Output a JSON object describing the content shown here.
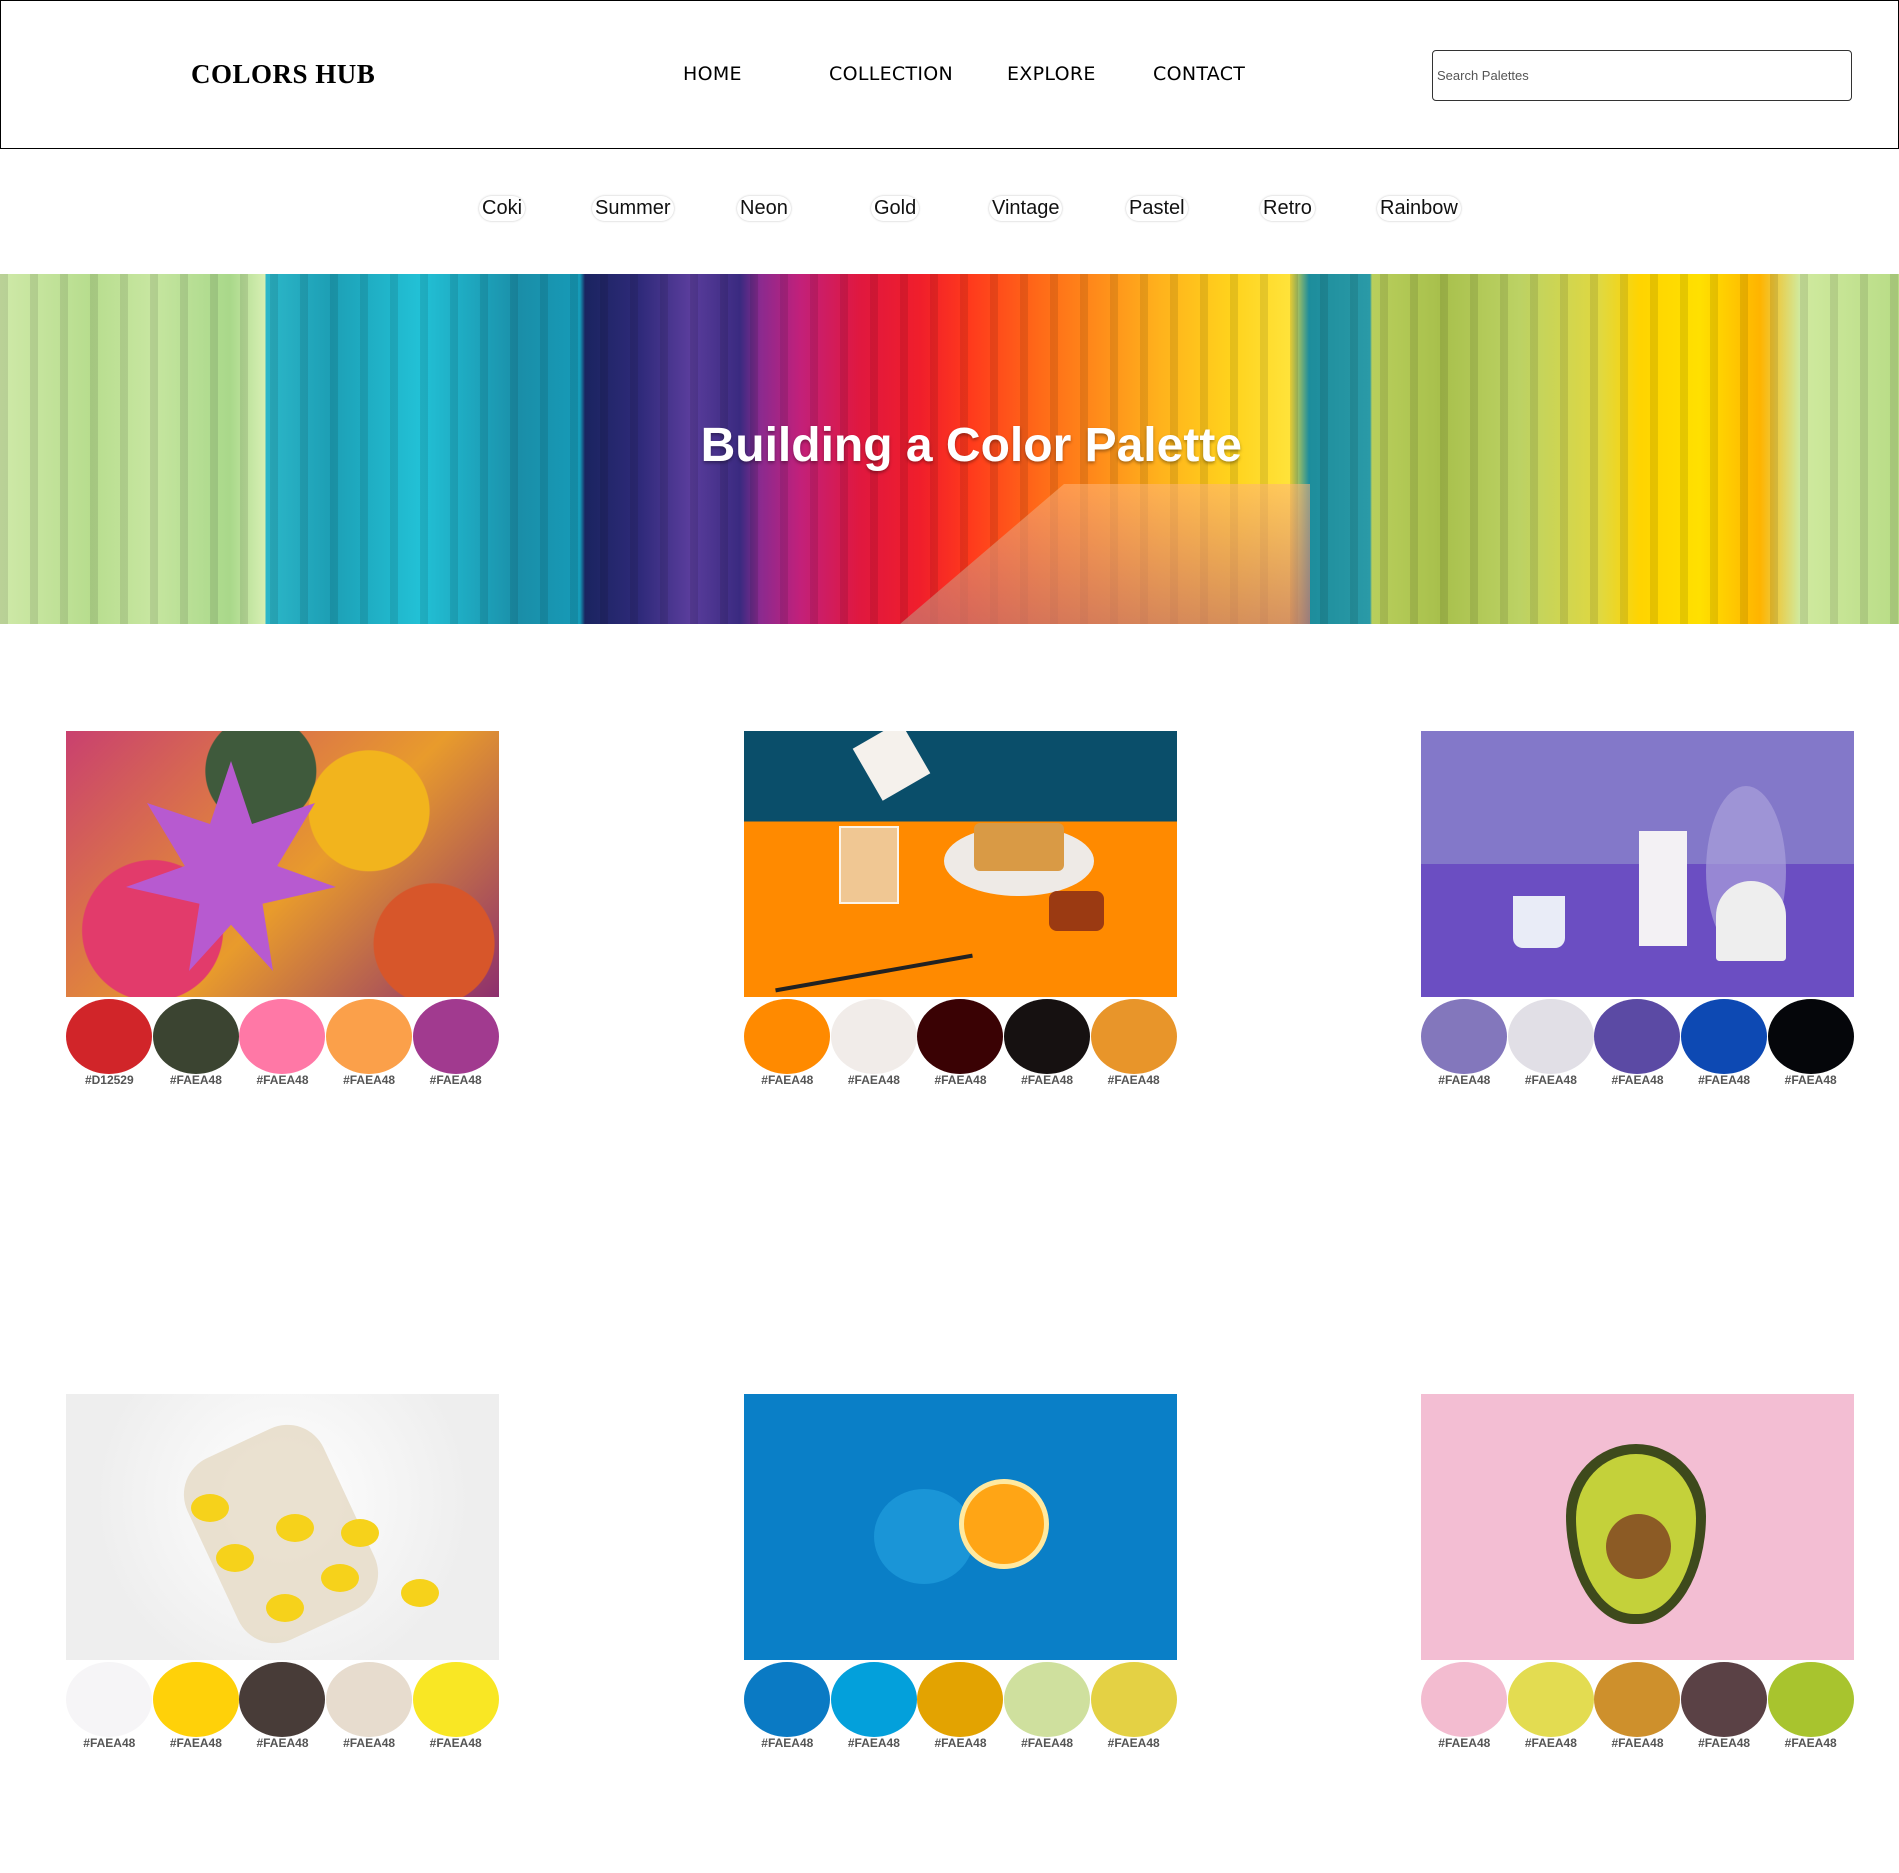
{
  "header": {
    "logo": "COLORS HUB",
    "nav": [
      "HOME",
      "COLLECTION",
      "EXPLORE",
      "CONTACT"
    ],
    "search_placeholder": "Search Palettes"
  },
  "categories": [
    "Coki",
    "Summer",
    "Neon",
    "Gold",
    "Vintage",
    "Pastel",
    "Retro",
    "Rainbow"
  ],
  "hero": {
    "title": "Building a Color Palette"
  },
  "palettes": [
    {
      "photo": "autumn-leaves",
      "colors": [
        "#D12529",
        "#3B4431",
        "#FF78A6",
        "#FBA04A",
        "#A13A8F"
      ],
      "labels": [
        "#D12529",
        "#FAEA48",
        "#FAEA48",
        "#FAEA48",
        "#FAEA48"
      ]
    },
    {
      "photo": "waffles-breakfast",
      "colors": [
        "#FF8A00",
        "#F1ECE9",
        "#3A0204",
        "#161111",
        "#E8952A"
      ],
      "labels": [
        "#FAEA48",
        "#FAEA48",
        "#FAEA48",
        "#FAEA48",
        "#FAEA48"
      ]
    },
    {
      "photo": "purple-still-life",
      "colors": [
        "#8377BC",
        "#E1DFE6",
        "#5B4AA4",
        "#0D49B3",
        "#05060A"
      ],
      "labels": [
        "#FAEA48",
        "#FAEA48",
        "#FAEA48",
        "#FAEA48",
        "#FAEA48"
      ]
    },
    {
      "photo": "lemons-net-bag",
      "colors": [
        "#F6F5F7",
        "#FFD109",
        "#483C38",
        "#E7DCCE",
        "#F9E724"
      ],
      "labels": [
        "#FAEA48",
        "#FAEA48",
        "#FAEA48",
        "#FAEA48",
        "#FAEA48"
      ]
    },
    {
      "photo": "blue-orange",
      "colors": [
        "#0A7AC4",
        "#03A0DB",
        "#E3A301",
        "#CFE09E",
        "#E4D144"
      ],
      "labels": [
        "#FAEA48",
        "#FAEA48",
        "#FAEA48",
        "#FAEA48",
        "#FAEA48"
      ]
    },
    {
      "photo": "avocado-pink",
      "colors": [
        "#F3BCD0",
        "#E3DC51",
        "#CE902C",
        "#5A4145",
        "#A8C42E"
      ],
      "labels": [
        "#FAEA48",
        "#FAEA48",
        "#FAEA48",
        "#FAEA48",
        "#FAEA48"
      ]
    }
  ]
}
